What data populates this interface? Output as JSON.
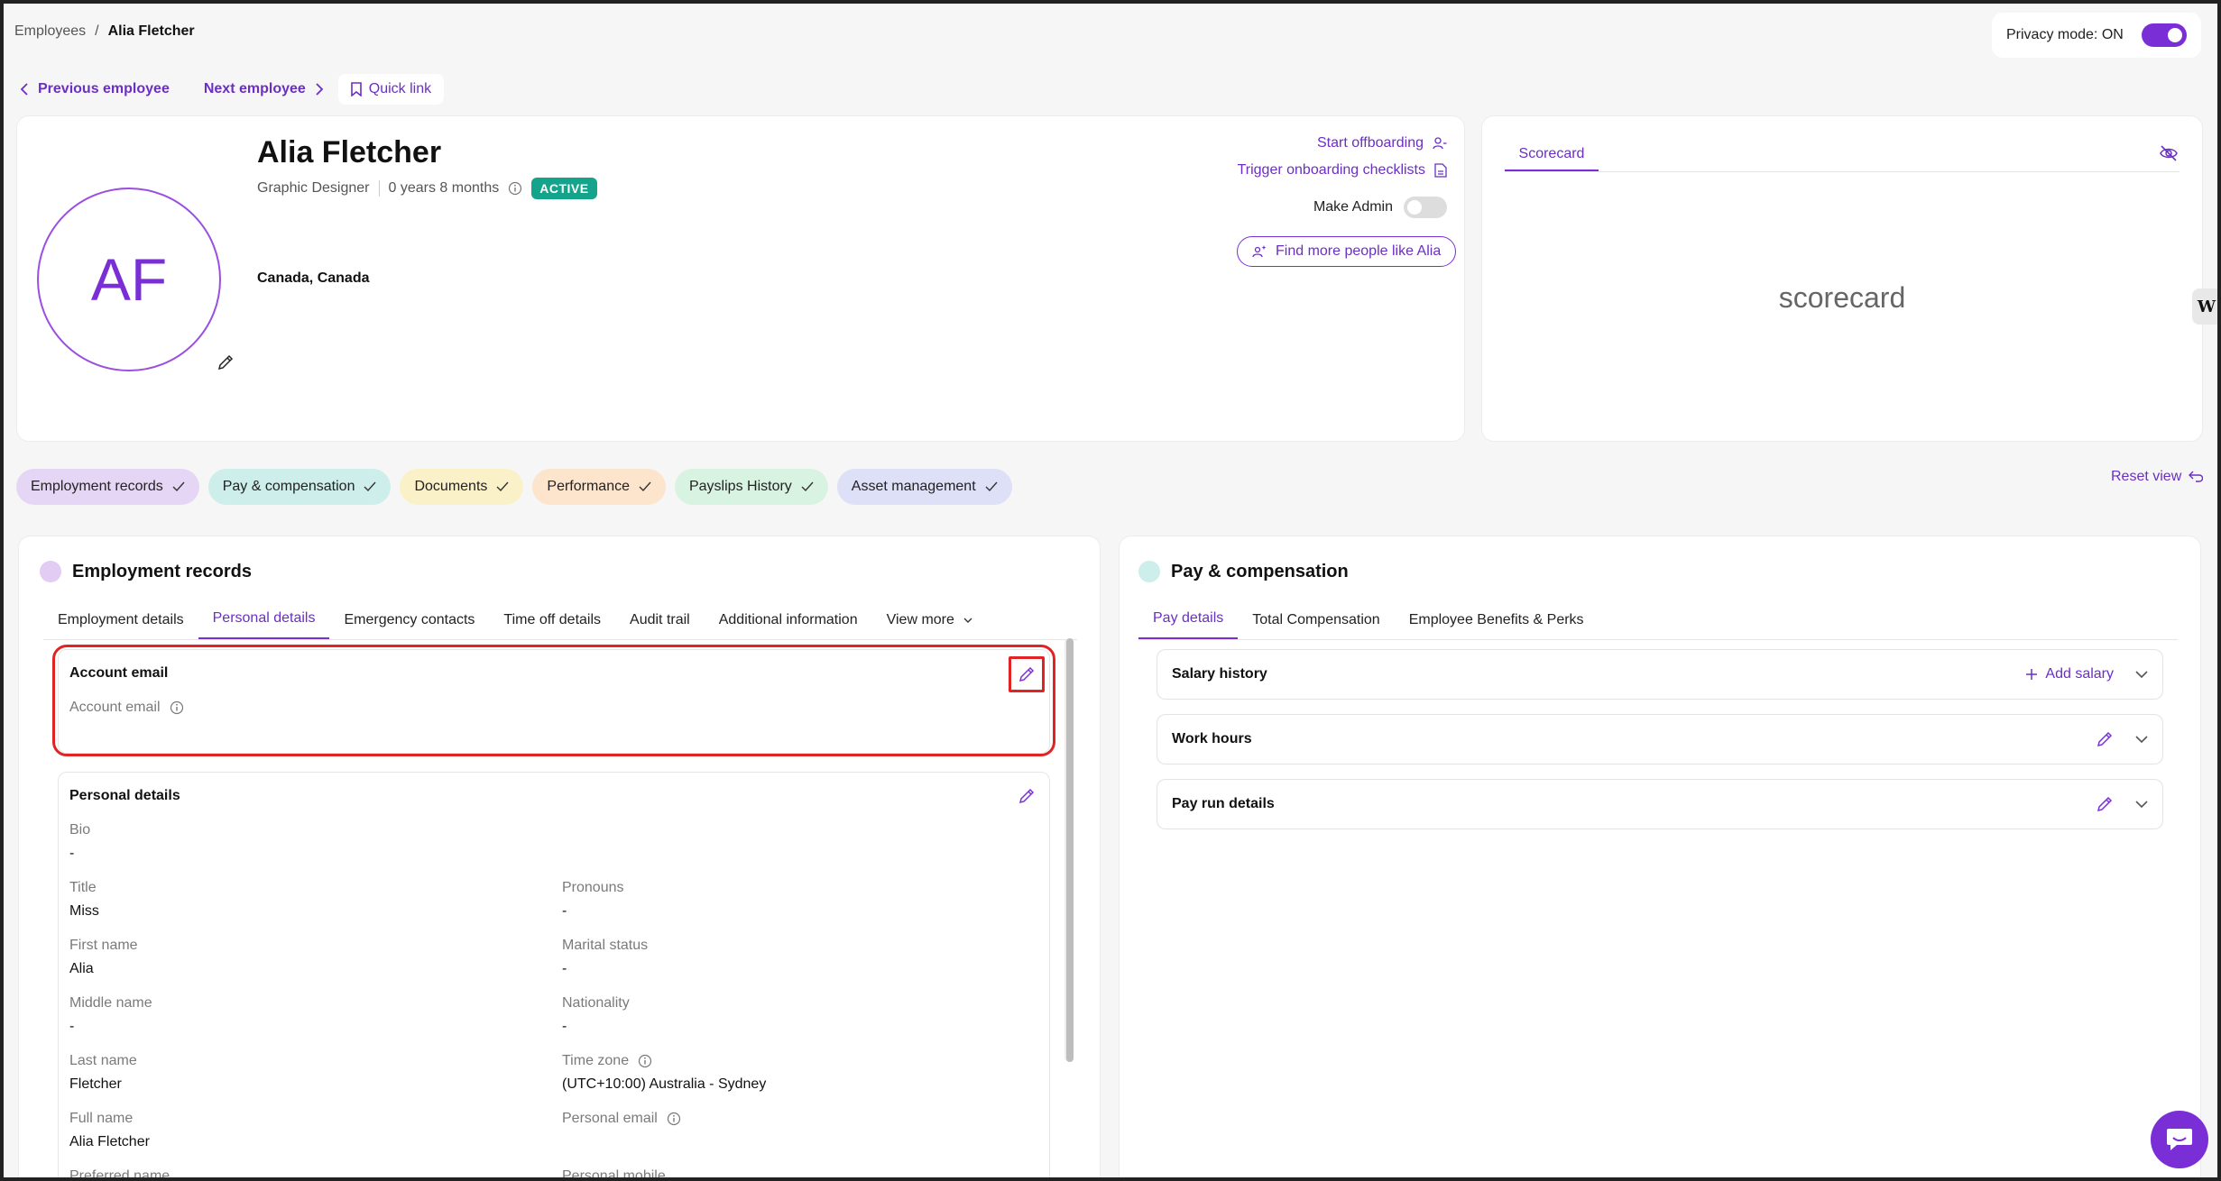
{
  "breadcrumb": {
    "parent": "Employees",
    "separator": "/",
    "current": "Alia Fletcher"
  },
  "privacy": {
    "label": "Privacy mode: ON",
    "enabled": true
  },
  "nav": {
    "previous": "Previous employee",
    "next": "Next employee",
    "quick_link": "Quick link"
  },
  "profile": {
    "initials": "AF",
    "name": "Alia Fletcher",
    "role": "Graphic Designer",
    "tenure": "0 years 8 months",
    "status": "ACTIVE",
    "location": "Canada, Canada",
    "actions": {
      "offboarding": "Start offboarding",
      "onboarding": "Trigger onboarding checklists",
      "make_admin": "Make Admin",
      "make_admin_enabled": false,
      "find_more": "Find more people like Alia"
    }
  },
  "scorecard": {
    "tab": "Scorecard",
    "content": "scorecard"
  },
  "chips": [
    {
      "label": "Employment records",
      "color": "#e6d6f5"
    },
    {
      "label": "Pay & compensation",
      "color": "#cdeeea"
    },
    {
      "label": "Documents",
      "color": "#fbf1c9"
    },
    {
      "label": "Performance",
      "color": "#fde4cc"
    },
    {
      "label": "Payslips History",
      "color": "#d8f3e1"
    },
    {
      "label": "Asset management",
      "color": "#dde0f7"
    }
  ],
  "reset_view": "Reset view",
  "employment": {
    "title": "Employment records",
    "dot_color": "#e2ccf4",
    "tabs": [
      "Employment details",
      "Personal details",
      "Emergency contacts",
      "Time off details",
      "Audit trail",
      "Additional information",
      "View more"
    ],
    "active_tab": "Personal details",
    "account_email": {
      "title": "Account email",
      "field_label": "Account email"
    },
    "personal": {
      "title": "Personal details",
      "bio_label": "Bio",
      "bio_value": "-",
      "title_label": "Title",
      "title_value": "Miss",
      "pronouns_label": "Pronouns",
      "pronouns_value": "-",
      "first_label": "First name",
      "first_value": "Alia",
      "marital_label": "Marital status",
      "marital_value": "-",
      "middle_label": "Middle name",
      "middle_value": "-",
      "nationality_label": "Nationality",
      "nationality_value": "-",
      "last_label": "Last name",
      "last_value": "Fletcher",
      "tz_label": "Time zone",
      "tz_value": "(UTC+10:00) Australia - Sydney",
      "full_label": "Full name",
      "full_value": "Alia Fletcher",
      "personal_email_label": "Personal email",
      "preferred_label": "Preferred name",
      "personal_mobile_label": "Personal mobile"
    }
  },
  "pay": {
    "title": "Pay & compensation",
    "dot_color": "#cdeeea",
    "tabs": [
      "Pay details",
      "Total Compensation",
      "Employee Benefits & Perks"
    ],
    "active_tab": "Pay details",
    "salary_history": "Salary history",
    "add_salary": "Add salary",
    "work_hours": "Work hours",
    "pay_run": "Pay run details"
  },
  "icons": {
    "edit": "pencil-icon",
    "check": "check-icon",
    "chevron": "chevron-icon",
    "info": "info-icon",
    "bookmark": "bookmark-icon",
    "eye_off": "eye-off-icon",
    "chat": "chat-icon",
    "reset": "reset-icon"
  },
  "colors": {
    "accent": "#7a2fd6",
    "active_badge": "#14a38b",
    "highlight": "#e02424"
  }
}
